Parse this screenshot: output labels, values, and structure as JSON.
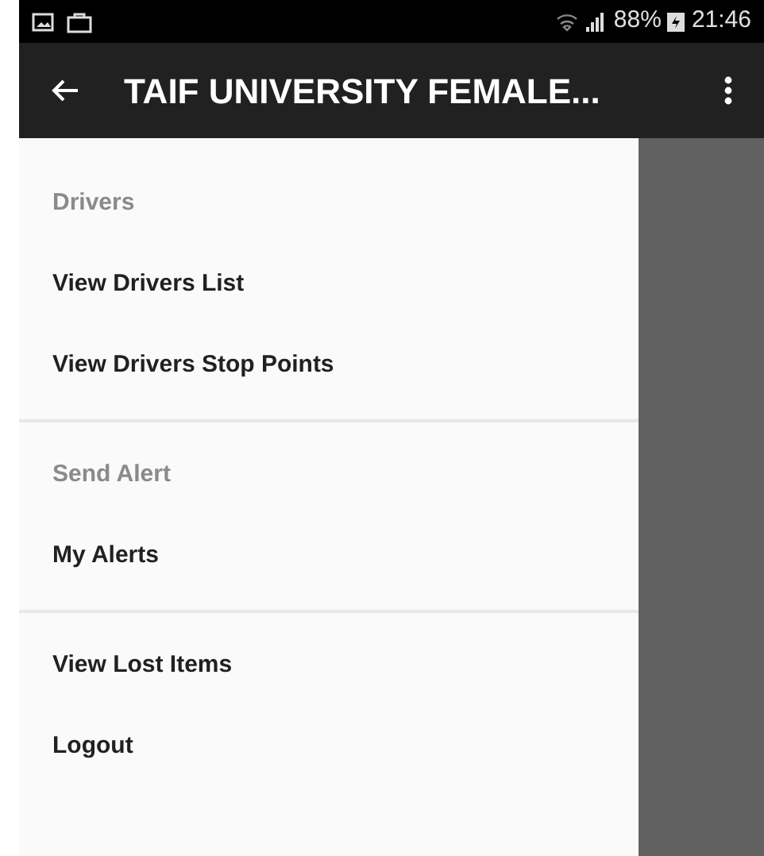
{
  "status_bar": {
    "battery": "88%",
    "time": "21:46"
  },
  "app_bar": {
    "title": "TAIF UNIVERSITY FEMALE..."
  },
  "drawer": {
    "sections": [
      {
        "header": "Drivers",
        "items": [
          "View Drivers List",
          "View Drivers Stop Points"
        ]
      },
      {
        "header": "Send Alert",
        "items": [
          "My Alerts"
        ]
      },
      {
        "items": [
          "View Lost Items",
          "Logout"
        ]
      }
    ]
  }
}
